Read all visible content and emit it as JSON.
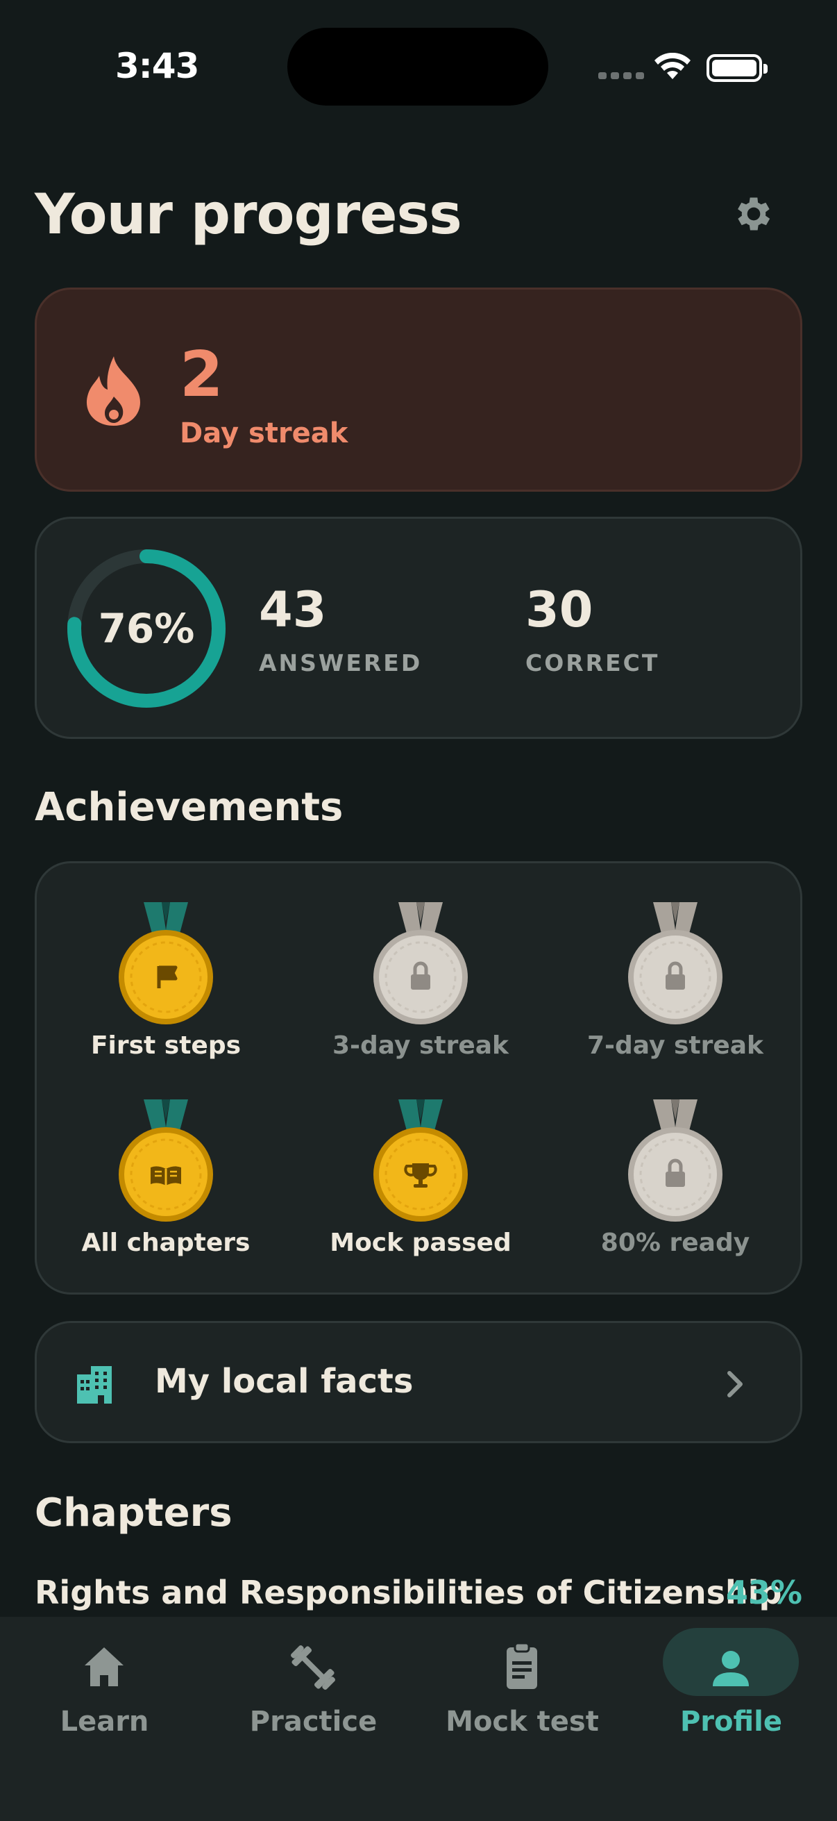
{
  "status_bar": {
    "time": "3:43"
  },
  "header": {
    "title": "Your progress"
  },
  "streak": {
    "count": "2",
    "label": "Day streak"
  },
  "stats": {
    "percent_label": "76%",
    "percent_value": 0.76,
    "answered_value": "43",
    "answered_label": "ANSWERED",
    "correct_value": "30",
    "correct_label": "CORRECT"
  },
  "achievements": {
    "title": "Achievements",
    "items": [
      {
        "label": "First steps",
        "icon": "flag-icon",
        "unlocked": true
      },
      {
        "label": "3-day streak",
        "icon": "lock-icon",
        "unlocked": false
      },
      {
        "label": "7-day streak",
        "icon": "lock-icon",
        "unlocked": false
      },
      {
        "label": "All chapters",
        "icon": "book-icon",
        "unlocked": true
      },
      {
        "label": "Mock passed",
        "icon": "trophy-icon",
        "unlocked": true
      },
      {
        "label": "80% ready",
        "icon": "lock-icon",
        "unlocked": false
      }
    ]
  },
  "local_facts": {
    "label": "My local facts"
  },
  "chapters": {
    "title": "Chapters",
    "items": [
      {
        "name": "Rights and Responsibilities of Citizenship",
        "percent": "43%"
      }
    ]
  },
  "tabs": [
    {
      "label": "Learn",
      "icon": "home-icon",
      "active": false
    },
    {
      "label": "Practice",
      "icon": "dumbbell-icon",
      "active": false
    },
    {
      "label": "Mock test",
      "icon": "clipboard-icon",
      "active": false
    },
    {
      "label": "Profile",
      "icon": "person-icon",
      "active": true
    }
  ],
  "colors": {
    "accent": "#4ec1b2",
    "streak": "#f08b6c",
    "gold": "#f2b719",
    "locked": "#d8d3cb"
  }
}
